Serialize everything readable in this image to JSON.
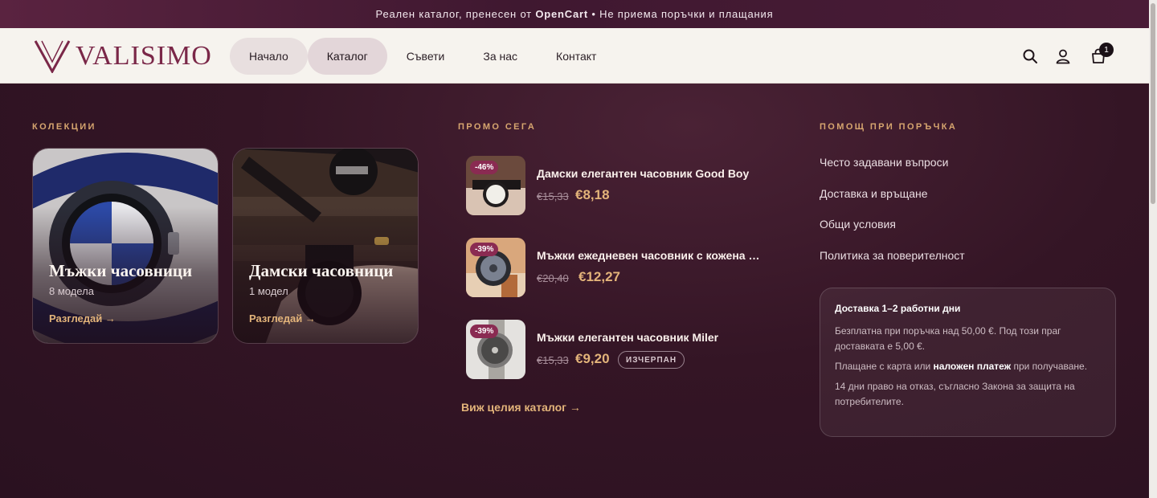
{
  "announcement": {
    "text_before": "Реален каталог, пренесен от ",
    "brand": "OpenCart",
    "text_after": " • Не приема поръчки и плащания"
  },
  "header": {
    "logo_text": "VALISIMO",
    "nav": [
      "Начало",
      "Каталог",
      "Съвети",
      "За нас",
      "Контакт"
    ],
    "cart_count": "1"
  },
  "mega": {
    "collections": {
      "title": "КОЛЕКЦИИ",
      "items": [
        {
          "name": "Мъжки часовници",
          "count": "8 модела",
          "link": "Разгледай →"
        },
        {
          "name": "Дамски часовници",
          "count": "1 модел",
          "link": "Разгледай →"
        }
      ]
    },
    "promo": {
      "title": "ПРОМО СЕГА",
      "items": [
        {
          "badge": "-46%",
          "name": "Дамски елегантен часовник Good Boy",
          "old_price": "€15,33",
          "new_price": "€8,18"
        },
        {
          "badge": "-39%",
          "name": "Мъжки ежедневен часовник с кожена …",
          "old_price": "€20,40",
          "new_price": "€12,27"
        },
        {
          "badge": "-39%",
          "name": "Мъжки елегантен часовник Miler",
          "old_price": "€15,33",
          "new_price": "€9,20",
          "status": "ИЗЧЕРПАН"
        }
      ],
      "view_all": "Виж целия каталог →"
    },
    "help": {
      "title": "ПОМОЩ ПРИ ПОРЪЧКА",
      "links": [
        "Често задавани въпроси",
        "Доставка и връщане",
        "Общи условия",
        "Политика за поверителност"
      ],
      "info": {
        "title": "Доставка 1–2 работни дни",
        "p1": "Безплатна при поръчка над 50,00 €. Под този праг доставката е 5,00 €.",
        "p2_before": "Плащане с карта или ",
        "p2_bold": "наложен платеж",
        "p2_after": " при получаване.",
        "p3": "14 дни право на отказ, съгласно Закона за защита на потребителите."
      }
    }
  },
  "colors": {
    "accent": "#e3b47a",
    "brand": "#7a2748",
    "badge": "#8a2b52"
  }
}
